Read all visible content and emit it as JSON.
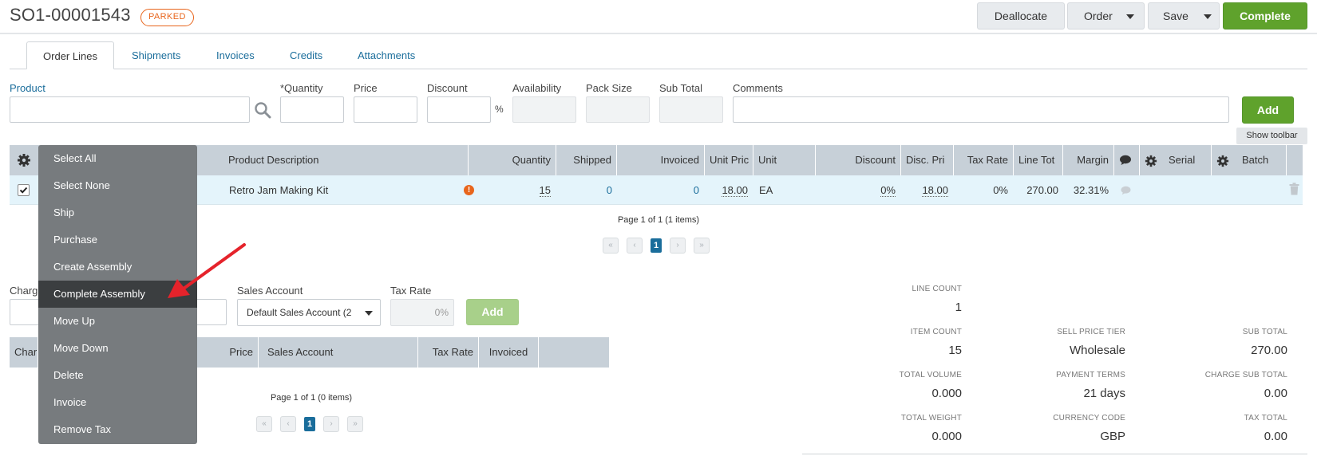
{
  "header": {
    "order_id": "SO1-00001543",
    "status": "PARKED",
    "buttons": {
      "deallocate": "Deallocate",
      "order": "Order",
      "save": "Save",
      "complete": "Complete"
    }
  },
  "tabs": [
    {
      "label": "Order Lines",
      "active": true
    },
    {
      "label": "Shipments"
    },
    {
      "label": "Invoices"
    },
    {
      "label": "Credits"
    },
    {
      "label": "Attachments"
    }
  ],
  "entry_form": {
    "product_label": "Product",
    "quantity_label": "*Quantity",
    "price_label": "Price",
    "discount_label": "Discount",
    "discount_suffix": "%",
    "availability_label": "Availability",
    "pack_size_label": "Pack Size",
    "sub_total_label": "Sub Total",
    "comments_label": "Comments",
    "add_label": "Add",
    "show_toolbar_label": "Show toolbar"
  },
  "lines_grid": {
    "columns": [
      "Product Description",
      "Quantity",
      "Shipped",
      "Invoiced",
      "Unit Pric",
      "Unit",
      "Discount",
      "Disc. Pri",
      "Tax Rate",
      "Line Tot",
      "Margin",
      "Serial",
      "Batch"
    ],
    "row": {
      "description": "Retro Jam Making Kit",
      "quantity": "15",
      "shipped": "0",
      "invoiced": "0",
      "unit_price": "18.00",
      "unit": "EA",
      "discount": "0%",
      "disc_price": "18.00",
      "tax_rate": "0%",
      "line_total": "270.00",
      "margin": "32.31%"
    },
    "pager_text": "Page 1 of 1 (1 items)",
    "current_page": "1"
  },
  "context_menu": {
    "items": [
      "Select All",
      "Select None",
      "Ship",
      "Purchase",
      "Create Assembly",
      "Complete Assembly",
      "Move Up",
      "Move Down",
      "Delete",
      "Invoice",
      "Remove Tax"
    ],
    "highlighted_index": 5
  },
  "charges_form": {
    "charge_label_partial": "Charg",
    "sales_account_label": "Sales Account",
    "sales_account_value": "Default Sales Account (2",
    "tax_rate_label": "Tax Rate",
    "tax_rate_placeholder": "0%",
    "add_label": "Add"
  },
  "charges_grid": {
    "columns": [
      "Char",
      "Price",
      "Sales Account",
      "Tax Rate",
      "Invoiced"
    ],
    "pager_text": "Page 1 of 1 (0 items)",
    "current_page": "1"
  },
  "summary": {
    "line_count_label": "LINE COUNT",
    "line_count": "1",
    "item_count_label": "ITEM COUNT",
    "item_count": "15",
    "sell_price_tier_label": "SELL PRICE TIER",
    "sell_price_tier": "Wholesale",
    "sub_total_label": "SUB TOTAL",
    "sub_total": "270.00",
    "total_volume_label": "TOTAL VOLUME",
    "total_volume": "0.000",
    "payment_terms_label": "PAYMENT TERMS",
    "payment_terms": "21 days",
    "charge_sub_total_label": "CHARGE SUB TOTAL",
    "charge_sub_total": "0.00",
    "total_weight_label": "TOTAL WEIGHT",
    "total_weight": "0.000",
    "currency_code_label": "CURRENCY CODE",
    "currency_code": "GBP",
    "tax_total_label": "TAX TOTAL",
    "tax_total": "0.00"
  },
  "colors": {
    "accent_green": "#5fa22c",
    "link_blue": "#1a6d9b",
    "status_orange": "#e8651c",
    "arrow_red": "#e5232b"
  },
  "icons": [
    "search-icon",
    "gear-icon",
    "comment-icon",
    "trash-icon",
    "warning-icon",
    "caret-down-icon"
  ]
}
